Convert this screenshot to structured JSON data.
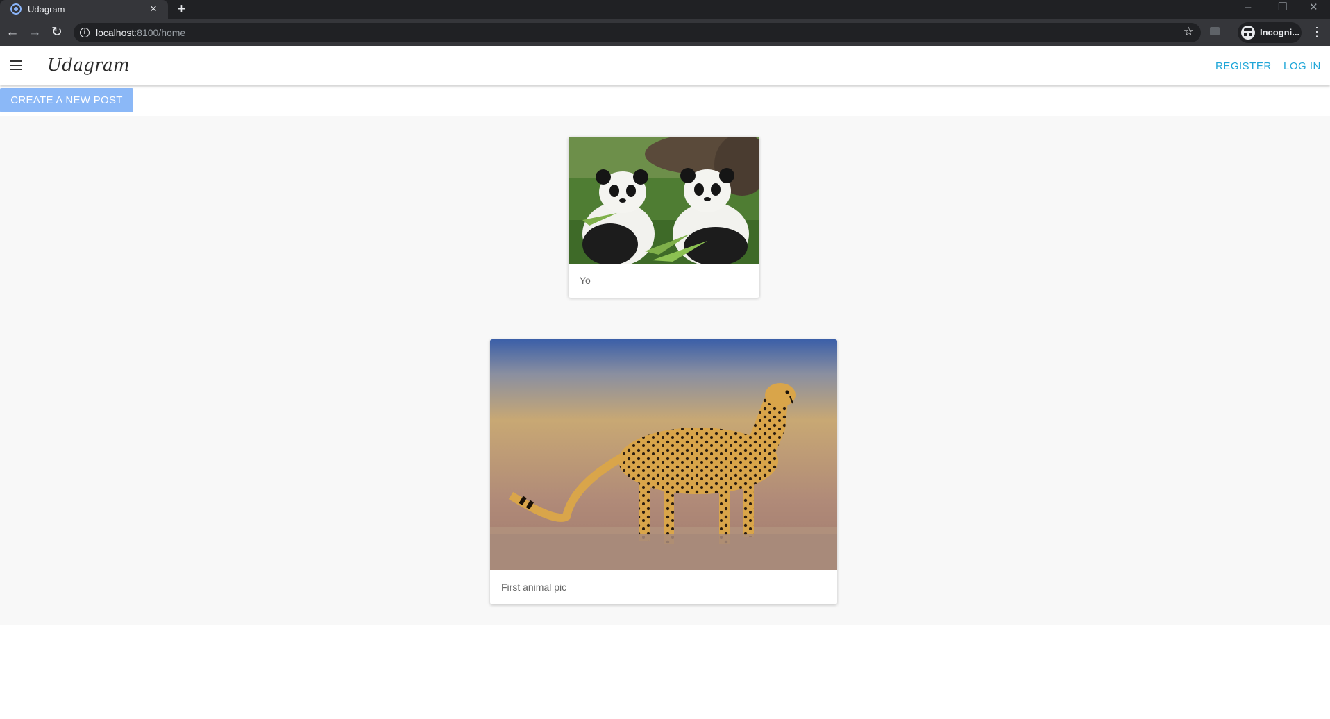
{
  "browser": {
    "tab_title": "Udagram",
    "url_host": "localhost",
    "url_rest": ":8100/home",
    "profile_label": "Incogni..."
  },
  "header": {
    "brand": "Udagram",
    "register_label": "REGISTER",
    "login_label": "LOG IN"
  },
  "actions": {
    "create_post_label": "CREATE A NEW POST"
  },
  "feed": {
    "posts": [
      {
        "caption": "Yo",
        "image": "panda-photo"
      },
      {
        "caption": "First animal pic",
        "image": "cheetah-photo"
      }
    ]
  },
  "colors": {
    "accent": "#1fa6d8",
    "create_button": "#8bb8f7",
    "chrome_dark": "#202124",
    "chrome_toolbar": "#35363a"
  }
}
